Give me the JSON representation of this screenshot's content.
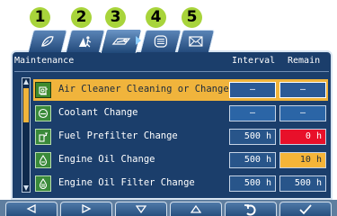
{
  "badges": [
    "1",
    "2",
    "3",
    "4",
    "5"
  ],
  "tabs": [
    {
      "name": "tab-1",
      "icon": "leaf-eco-icon",
      "active": false
    },
    {
      "name": "tab-2",
      "icon": "worker-service-icon",
      "active": false
    },
    {
      "name": "tab-3",
      "icon": "maintenance-wrench-icon",
      "active": true
    },
    {
      "name": "tab-4",
      "icon": "list-menu-icon",
      "active": false
    },
    {
      "name": "tab-5",
      "icon": "envelope-icon",
      "active": false
    }
  ],
  "table": {
    "headers": {
      "item": "Maintenance",
      "interval": "Interval",
      "remain": "Remain"
    },
    "rows": [
      {
        "label": "Air Cleaner Cleaning or Change",
        "icon": "air-cleaner-icon",
        "interval": "—",
        "remain": "—",
        "selected": true
      },
      {
        "label": "Coolant Change",
        "icon": "coolant-icon",
        "interval": "—",
        "remain": "—",
        "selected": false
      },
      {
        "label": "Fuel Prefilter Change",
        "icon": "fuel-prefilter-icon",
        "interval": "500",
        "interval_unit": "h",
        "remain": "0",
        "remain_unit": "h",
        "remain_status": "red",
        "selected": false
      },
      {
        "label": "Engine Oil Change",
        "icon": "engine-oil-icon",
        "interval": "500",
        "interval_unit": "h",
        "remain": "10",
        "remain_unit": "h",
        "remain_status": "amber",
        "selected": false
      },
      {
        "label": "Engine Oil Filter Change",
        "icon": "engine-oil-filter-icon",
        "interval": "500",
        "interval_unit": "h",
        "remain": "500",
        "remain_unit": "h",
        "selected": false
      }
    ]
  },
  "footer_buttons": [
    {
      "name": "left-button",
      "icon": "triangle-left-icon"
    },
    {
      "name": "right-button",
      "icon": "triangle-right-icon"
    },
    {
      "name": "down-button",
      "icon": "triangle-down-icon"
    },
    {
      "name": "up-button",
      "icon": "triangle-up-icon"
    },
    {
      "name": "back-button",
      "icon": "return-arrow-icon"
    },
    {
      "name": "confirm-button",
      "icon": "checkmark-icon"
    }
  ],
  "colors": {
    "panel": "#1b3e6b",
    "selected_row": "#f0b43c",
    "alert_red": "#e8102a",
    "warning_amber": "#f5b538",
    "badge_green": "#a8d43b"
  }
}
